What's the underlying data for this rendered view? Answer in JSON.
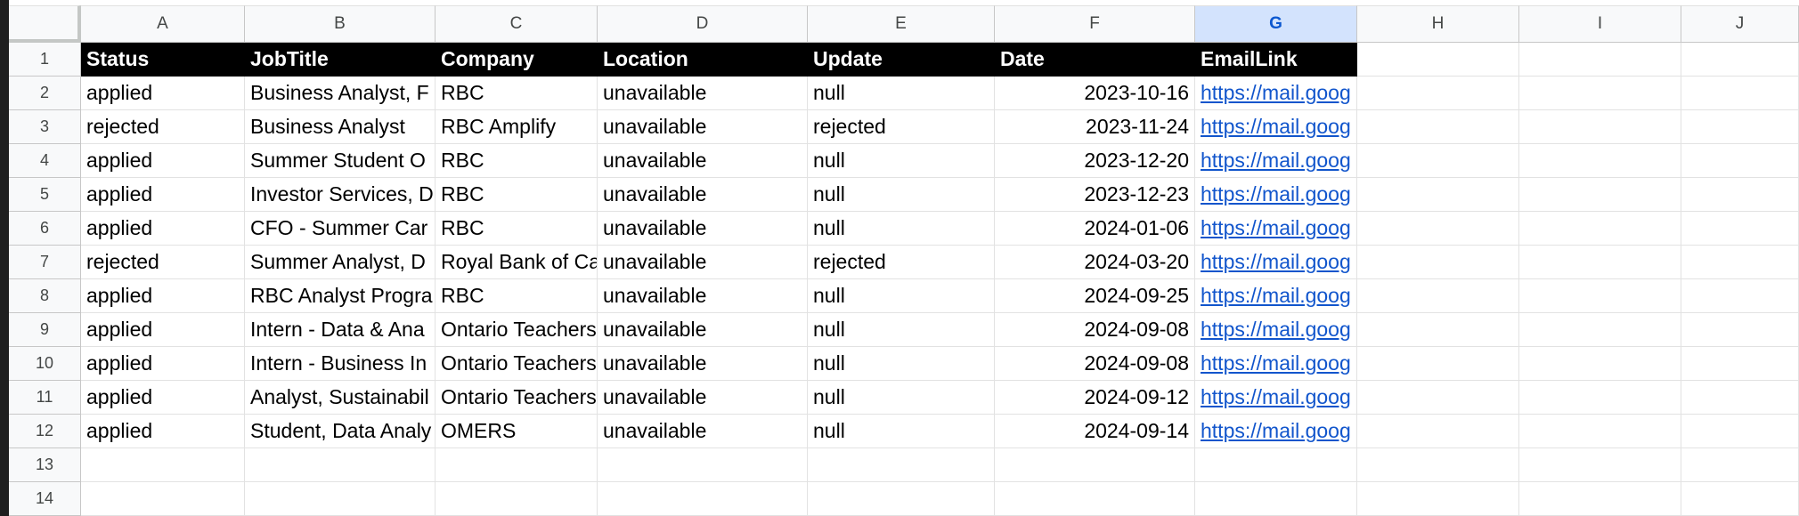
{
  "columns": [
    "A",
    "B",
    "C",
    "D",
    "E",
    "F",
    "G",
    "H",
    "I",
    "J"
  ],
  "selected_column": "G",
  "row_numbers": [
    "1",
    "2",
    "3",
    "4",
    "5",
    "6",
    "7",
    "8",
    "9",
    "10",
    "11",
    "12",
    "13",
    "14"
  ],
  "header": [
    "Status",
    "JobTitle",
    "Company",
    "Location",
    "Update",
    "Date",
    "EmailLink"
  ],
  "rows": [
    [
      "applied",
      "Business Analyst, F",
      "RBC",
      "unavailable",
      "null",
      "2023-10-16",
      "https://mail.goog"
    ],
    [
      "rejected",
      "Business Analyst",
      "RBC Amplify",
      "unavailable",
      "rejected",
      "2023-11-24",
      "https://mail.goog"
    ],
    [
      "applied",
      "Summer Student O",
      "RBC",
      "unavailable",
      "null",
      "2023-12-20",
      "https://mail.goog"
    ],
    [
      "applied",
      "Investor Services, D",
      "RBC",
      "unavailable",
      "null",
      "2023-12-23",
      "https://mail.goog"
    ],
    [
      "applied",
      "CFO - Summer Car",
      "RBC",
      "unavailable",
      "null",
      "2024-01-06",
      "https://mail.goog"
    ],
    [
      "rejected",
      "Summer Analyst, D",
      "Royal Bank of Ca",
      "unavailable",
      "rejected",
      "2024-03-20",
      "https://mail.goog"
    ],
    [
      "applied",
      "RBC Analyst Progra",
      "RBC",
      "unavailable",
      "null",
      "2024-09-25",
      "https://mail.goog"
    ],
    [
      "applied",
      "Intern - Data & Ana",
      "Ontario Teachers",
      "unavailable",
      "null",
      "2024-09-08",
      "https://mail.goog"
    ],
    [
      "applied",
      "Intern - Business In",
      "Ontario Teachers",
      "unavailable",
      "null",
      "2024-09-08",
      "https://mail.goog"
    ],
    [
      "applied",
      "Analyst, Sustainabil",
      "Ontario Teachers",
      "unavailable",
      "null",
      "2024-09-12",
      "https://mail.goog"
    ],
    [
      "applied",
      "Student, Data Analy",
      "OMERS",
      "unavailable",
      "null",
      "2024-09-14",
      "https://mail.goog"
    ]
  ],
  "colors": {
    "header_bg": "#000000",
    "header_text": "#ffffff",
    "link": "#1155cc",
    "selected_column_bg": "#d3e3fd",
    "selected_column_text": "#0b57d0"
  }
}
